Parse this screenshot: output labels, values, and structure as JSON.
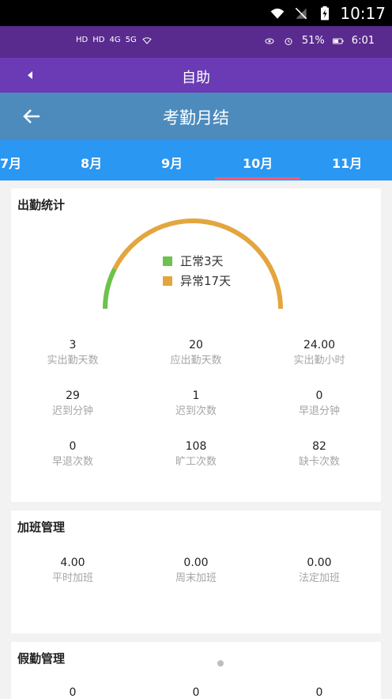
{
  "system_bar": {
    "time": "10:17"
  },
  "status_bar": {
    "left_labels": [
      "HD",
      "HD",
      "4G",
      "5G"
    ],
    "battery": "51%",
    "time": "6:01"
  },
  "app_bar": {
    "title": "自助"
  },
  "page": {
    "title": "考勤月结"
  },
  "month_tabs": [
    {
      "label": "7月"
    },
    {
      "label": "8月"
    },
    {
      "label": "9月"
    },
    {
      "label": "10月",
      "selected": true
    },
    {
      "label": "11月"
    }
  ],
  "attendance": {
    "header": "出勤统计",
    "legend": [
      {
        "label": "正常3天",
        "color": "#6cc24a"
      },
      {
        "label": "异常17天",
        "color": "#e3a63f"
      }
    ],
    "chart_data": {
      "type": "pie",
      "categories": [
        "正常",
        "异常"
      ],
      "values": [
        3,
        17
      ],
      "title": "",
      "colors": [
        "#6cc24a",
        "#e3a63f"
      ]
    },
    "stats": [
      [
        {
          "value": "3",
          "label": "实出勤天数"
        },
        {
          "value": "20",
          "label": "应出勤天数"
        },
        {
          "value": "24.00",
          "label": "实出勤小时"
        }
      ],
      [
        {
          "value": "29",
          "label": "迟到分钟"
        },
        {
          "value": "1",
          "label": "迟到次数"
        },
        {
          "value": "0",
          "label": "早退分钟"
        }
      ],
      [
        {
          "value": "0",
          "label": "早退次数"
        },
        {
          "value": "108",
          "label": "旷工次数"
        },
        {
          "value": "82",
          "label": "缺卡次数"
        }
      ]
    ]
  },
  "overtime": {
    "header": "加班管理",
    "items": [
      {
        "value": "4.00",
        "label": "平时加班"
      },
      {
        "value": "0.00",
        "label": "周末加班"
      },
      {
        "value": "0.00",
        "label": "法定加班"
      }
    ]
  },
  "leave": {
    "header": "假勤管理",
    "items": [
      {
        "value": "0"
      },
      {
        "value": "0"
      },
      {
        "value": "0"
      }
    ]
  },
  "colors": {
    "status_purple": "#5a2b8e",
    "app_purple": "#6a3bb4",
    "page_blue": "#4d8bbd",
    "tabs_blue": "#2a97f2",
    "selected_tab_indicator": "#ff5a7a"
  }
}
